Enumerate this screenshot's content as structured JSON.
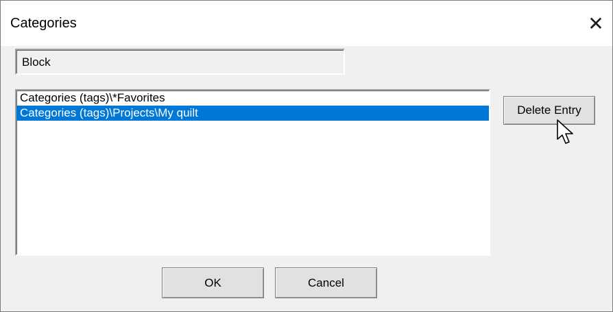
{
  "window": {
    "title": "Categories",
    "close_glyph": "✕"
  },
  "name_field": {
    "value": "Block"
  },
  "category_list": {
    "items": [
      {
        "label": "Categories (tags)\\*Favorites",
        "selected": false
      },
      {
        "label": "Categories (tags)\\Projects\\My quilt",
        "selected": true
      }
    ]
  },
  "buttons": {
    "delete_entry": "Delete Entry",
    "ok": "OK",
    "cancel": "Cancel"
  },
  "colors": {
    "selection": "#0078d7",
    "dialog_background": "#f0f0f0"
  },
  "icons": {
    "close": "close-icon",
    "cursor": "mouse-pointer-icon"
  }
}
